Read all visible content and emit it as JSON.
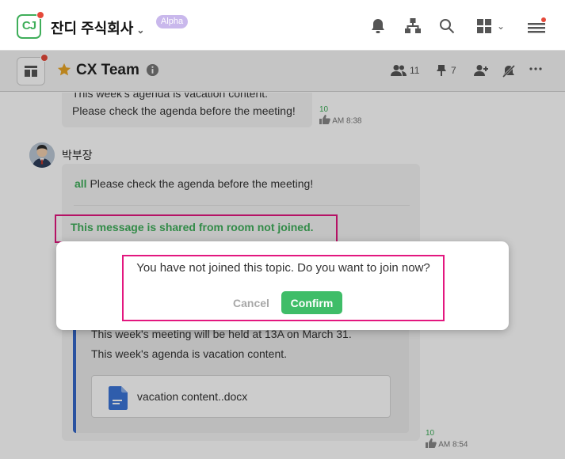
{
  "header": {
    "company_name": "잔디 주식회사",
    "company_chevron": "⌄",
    "badge": "Alpha",
    "logo_text": "CJ",
    "icons": [
      "bell-icon",
      "org-chart-icon",
      "search-icon",
      "apps-grid-icon",
      "menu-icon"
    ],
    "apps_chevron": "⌄"
  },
  "channel": {
    "title": "CX Team",
    "members_count": "11",
    "pins_count": "7",
    "icons": [
      "panel-icon",
      "star-icon",
      "info-icon",
      "members-icon",
      "pin-icon",
      "invite-icon",
      "mute-icon",
      "more-icon"
    ]
  },
  "messages": [
    {
      "lines": [
        "This week's agenda is vacation content.",
        "Please check the agenda before the meeting!"
      ],
      "unread": "10",
      "time": "AM 8:38"
    },
    {
      "sender": "박부장",
      "mention": "all",
      "text": "Please check the agenda before the meeting!",
      "shared_prefix": "This message is shared from ",
      "shared_room": "room not joined.",
      "quote_lines": [
        "This week's meeting will be held at 13A on March 31.",
        "This week's agenda is vacation content."
      ],
      "file_name": "vacation content..docx",
      "unread": "10",
      "time": "AM 8:54"
    }
  ],
  "dialog": {
    "question": "You have not joined this topic. Do you want to join now?",
    "cancel_label": "Cancel",
    "confirm_label": "Confirm"
  },
  "colors": {
    "accent_green": "#3fae5a",
    "confirm_green": "#3fbd68",
    "highlight_pink": "#e3177f",
    "notification_red": "#e5493a",
    "alpha_badge": "#c9b8ec",
    "quote_border": "#3567c8"
  }
}
